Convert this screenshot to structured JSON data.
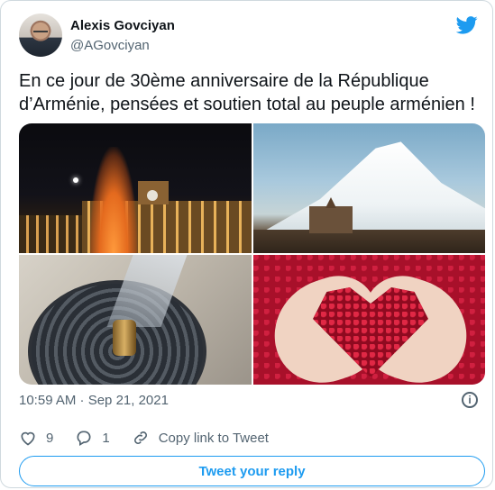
{
  "tweet": {
    "author_name": "Alexis Govciyan",
    "author_handle": "@AGovciyan",
    "text": "En ce jour de 30ème anniversaire de la République d’Arménie, pensées et soutien total au peuple arménien !",
    "timestamp": "10:59 AM · Sep 21, 2021",
    "likes": "9",
    "replies": "1",
    "copy_link_label": "Copy link to Tweet",
    "reply_button_label": "Tweet your reply"
  },
  "icons": {
    "brand": "twitter-bird-icon",
    "info": "info-icon",
    "like": "heart-icon",
    "reply": "reply-bubble-icon",
    "link": "link-icon"
  },
  "colors": {
    "accent": "#1d9bf0",
    "secondary_text": "#536471",
    "primary_text": "#0f1419",
    "border": "#cfd9de"
  }
}
